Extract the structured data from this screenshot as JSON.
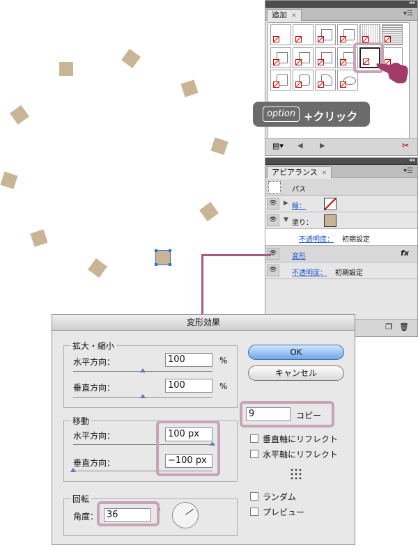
{
  "swatch_panel": {
    "tab_label": "追加",
    "nav_prev": "◀",
    "nav_next": "▶"
  },
  "callout": {
    "key": "option",
    "action": "+クリック"
  },
  "appearance_panel": {
    "tab_label": "アピアランス",
    "target": "パス",
    "stroke_label": "線：",
    "fill_label": "塗り：",
    "fill_opacity_label": "不透明度：",
    "fill_opacity_value": "初期設定",
    "effect_label": "変形",
    "fx_label": "fx",
    "opacity_label": "不透明度：",
    "opacity_value": "初期設定"
  },
  "dialog": {
    "title": "変形効果",
    "scale_group": "拡大・縮小",
    "horizontal_label": "水平方向：",
    "vertical_label": "垂直方向：",
    "scale_h_value": "100",
    "scale_v_value": "100",
    "percent": "%",
    "move_group": "移動",
    "move_h_value": "100 px",
    "move_v_value": "−100 px",
    "rotate_group": "回転",
    "angle_label": "角度：",
    "angle_value": "36",
    "degree": "°",
    "ok": "OK",
    "cancel": "キャンセル",
    "copies_value": "9",
    "copies_label": "コピー",
    "reflect_v": "垂直軸にリフレクト",
    "reflect_h": "水平軸にリフレクト",
    "random": "ランダム",
    "preview": "プレビュー",
    "reflect_v_checked": false,
    "reflect_h_checked": false,
    "random_checked": false,
    "preview_checked": false
  },
  "colors": {
    "shape_fill": "#c9b496",
    "highlight": "#c7a3b6",
    "pointer": "#a23a6a",
    "ok_button": "#6fa6e8"
  }
}
